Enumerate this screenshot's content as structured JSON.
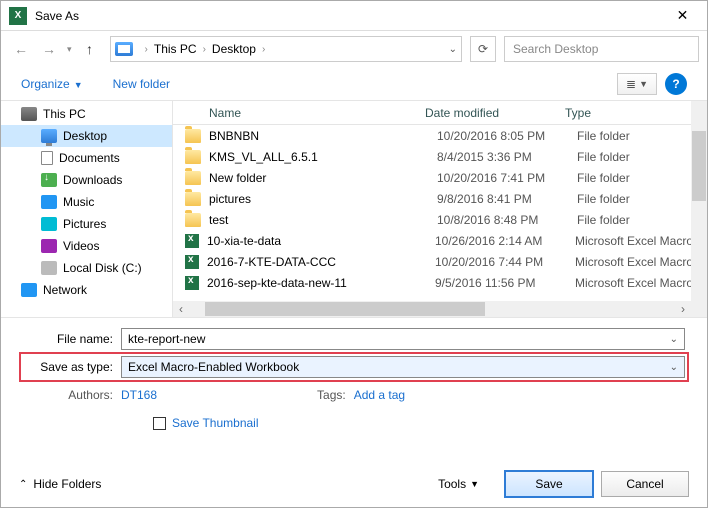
{
  "title": "Save As",
  "nav": {
    "breadcrumb": [
      "This PC",
      "Desktop"
    ],
    "search_placeholder": "Search Desktop"
  },
  "toolbar": {
    "organize": "Organize",
    "new_folder": "New folder"
  },
  "sidebar": {
    "items": [
      {
        "label": "This PC",
        "icon": "pc",
        "indent": false,
        "sel": false
      },
      {
        "label": "Desktop",
        "icon": "monitor",
        "indent": true,
        "sel": true
      },
      {
        "label": "Documents",
        "icon": "doc",
        "indent": true,
        "sel": false
      },
      {
        "label": "Downloads",
        "icon": "down",
        "indent": true,
        "sel": false
      },
      {
        "label": "Music",
        "icon": "music",
        "indent": true,
        "sel": false
      },
      {
        "label": "Pictures",
        "icon": "pic",
        "indent": true,
        "sel": false
      },
      {
        "label": "Videos",
        "icon": "vid",
        "indent": true,
        "sel": false
      },
      {
        "label": "Local Disk (C:)",
        "icon": "disk",
        "indent": true,
        "sel": false
      },
      {
        "label": "Network",
        "icon": "net",
        "indent": false,
        "sel": false
      }
    ]
  },
  "columns": {
    "name": "Name",
    "date": "Date modified",
    "type": "Type"
  },
  "files": [
    {
      "name": "BNBNBN",
      "date": "10/20/2016 8:05 PM",
      "type": "File folder",
      "kind": "folder"
    },
    {
      "name": "KMS_VL_ALL_6.5.1",
      "date": "8/4/2015 3:36 PM",
      "type": "File folder",
      "kind": "folder"
    },
    {
      "name": "New folder",
      "date": "10/20/2016 7:41 PM",
      "type": "File folder",
      "kind": "folder"
    },
    {
      "name": "pictures",
      "date": "9/8/2016 8:41 PM",
      "type": "File folder",
      "kind": "folder"
    },
    {
      "name": "test",
      "date": "10/8/2016 8:48 PM",
      "type": "File folder",
      "kind": "folder"
    },
    {
      "name": "10-xia-te-data",
      "date": "10/26/2016 2:14 AM",
      "type": "Microsoft Excel Macro-",
      "kind": "xlsm"
    },
    {
      "name": "2016-7-KTE-DATA-CCC",
      "date": "10/20/2016 7:44 PM",
      "type": "Microsoft Excel Macro-",
      "kind": "xlsm"
    },
    {
      "name": "2016-sep-kte-data-new-11",
      "date": "9/5/2016 11:56 PM",
      "type": "Microsoft Excel Macro-",
      "kind": "xlsm"
    }
  ],
  "form": {
    "filename_label": "File name:",
    "filename_value": "kte-report-new",
    "savetype_label": "Save as type:",
    "savetype_value": "Excel Macro-Enabled Workbook",
    "authors_label": "Authors:",
    "authors_value": "DT168",
    "tags_label": "Tags:",
    "tags_value": "Add a tag",
    "save_thumbnail": "Save Thumbnail"
  },
  "footer": {
    "hide_folders": "Hide Folders",
    "tools": "Tools",
    "save": "Save",
    "cancel": "Cancel"
  }
}
